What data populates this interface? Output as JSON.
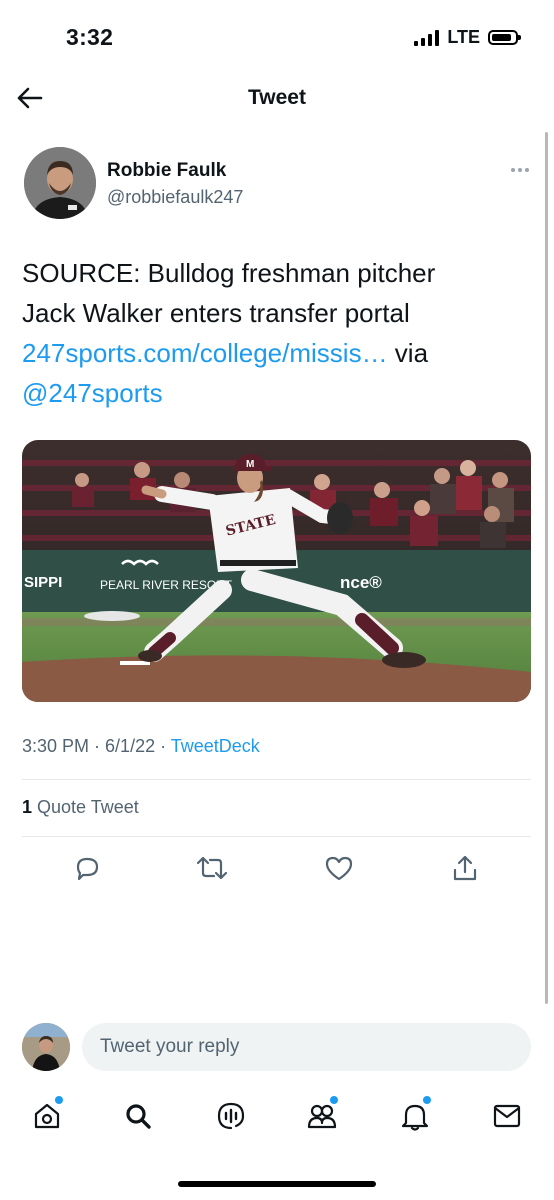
{
  "status_bar": {
    "time": "3:32",
    "network": "LTE"
  },
  "header": {
    "title": "Tweet"
  },
  "tweet": {
    "author_name": "Robbie Faulk",
    "author_handle": "@robbiefaulk247",
    "text_line1": "SOURCE: Bulldog freshman pitcher",
    "text_line2": "Jack Walker enters transfer portal",
    "link_text": "247sports.com/college/missis…",
    "via_text": " via",
    "mention": "@247sports",
    "media": {
      "board_left": "SIPPI",
      "board_sponsor": "PEARL RIVER RESORT",
      "board_right": "nce®",
      "jersey_text": "STATE",
      "cap_letter": "M"
    },
    "time": "3:30 PM",
    "separator": " · ",
    "date": "6/1/22",
    "source": "TweetDeck",
    "quote_count": "1",
    "quote_label": " Quote Tweet"
  },
  "actions": [
    "reply-icon",
    "retweet-icon",
    "like-icon",
    "share-icon"
  ],
  "reply": {
    "placeholder": "Tweet your reply"
  },
  "tabs": [
    "home-icon",
    "search-icon",
    "spaces-icon",
    "communities-icon",
    "notifications-icon",
    "messages-icon"
  ],
  "colors": {
    "accent": "#1d9bf0",
    "text": "#0f1419",
    "muted": "#536471"
  }
}
